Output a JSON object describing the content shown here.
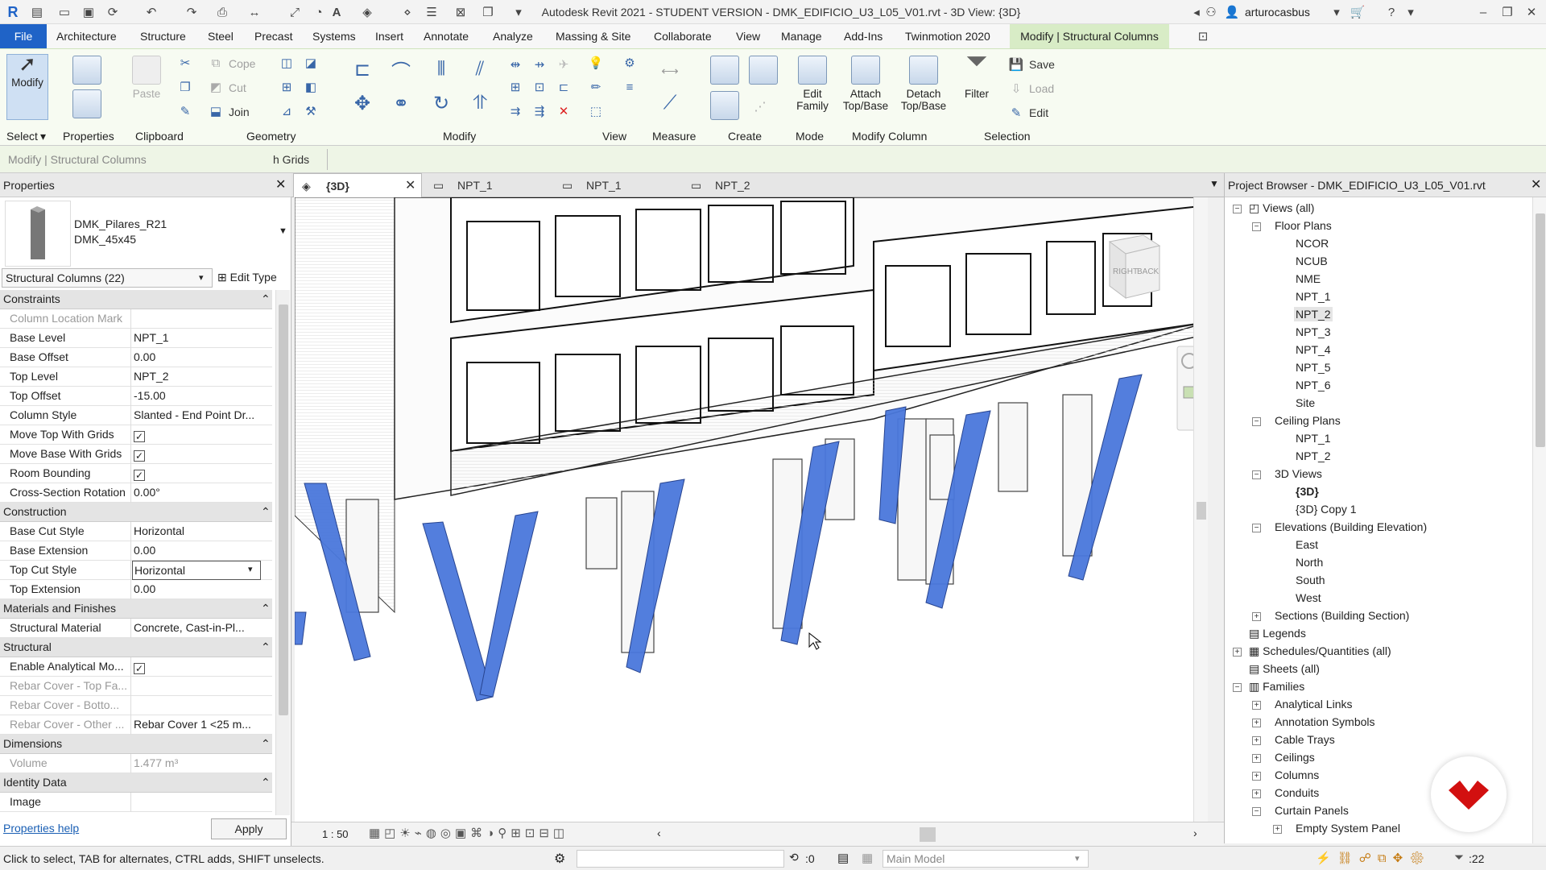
{
  "app": {
    "title": "Autodesk Revit 2021 - STUDENT VERSION - DMK_EDIFICIO_U3_L05_V01.rvt - 3D View: {3D}",
    "username": "arturocasbus"
  },
  "menu": [
    "File",
    "Architecture",
    "Structure",
    "Steel",
    "Precast",
    "Systems",
    "Insert",
    "Annotate",
    "Analyze",
    "Massing & Site",
    "Collaborate",
    "View",
    "Manage",
    "Add-Ins",
    "Twinmotion 2020",
    "Modify | Structural Columns"
  ],
  "ribbon": {
    "modify_label": "Modify",
    "paste_label": "Paste",
    "cope_label": "Cope",
    "cut_label": "Cut",
    "join_label": "Join",
    "edit_family_label": "Edit Family",
    "attach_label": "Attach Top/Base",
    "detach_label": "Detach Top/Base",
    "filter_label": "Filter",
    "save_label": "Save",
    "load_label": "Load",
    "edit_label": "Edit",
    "groups": [
      "Select",
      "Properties",
      "Clipboard",
      "Geometry",
      "Modify",
      "View",
      "Measure",
      "Create",
      "Mode",
      "Modify Column",
      "Selection"
    ]
  },
  "optionsbar": {
    "context_label": "Modify | Structural Columns",
    "grids_label": "h Grids"
  },
  "properties": {
    "title": "Properties",
    "family_name": "DMK_Pilares_R21",
    "type_name": "DMK_45x45",
    "selector": "Structural Columns (22)",
    "edit_type": "Edit Type",
    "groups": {
      "constraints": "Constraints",
      "construction": "Construction",
      "materials": "Materials and Finishes",
      "structural": "Structural",
      "dimensions": "Dimensions",
      "identity": "Identity Data"
    },
    "rows": {
      "col_location_mark": {
        "k": "Column Location Mark",
        "v": ""
      },
      "base_level": {
        "k": "Base Level",
        "v": "NPT_1"
      },
      "base_offset": {
        "k": "Base Offset",
        "v": "0.00"
      },
      "top_level": {
        "k": "Top Level",
        "v": "NPT_2"
      },
      "top_offset": {
        "k": "Top Offset",
        "v": "-15.00"
      },
      "column_style": {
        "k": "Column Style",
        "v": "Slanted - End Point Dr..."
      },
      "move_top": {
        "k": "Move Top With Grids",
        "v": "✓"
      },
      "move_base": {
        "k": "Move Base With Grids",
        "v": "✓"
      },
      "room_bounding": {
        "k": "Room Bounding",
        "v": "✓"
      },
      "cs_rotation": {
        "k": "Cross-Section Rotation",
        "v": "0.00°"
      },
      "base_cut_style": {
        "k": "Base Cut Style",
        "v": "Horizontal"
      },
      "base_extension": {
        "k": "Base Extension",
        "v": "0.00"
      },
      "top_cut_style": {
        "k": "Top Cut Style",
        "v": "Horizontal"
      },
      "top_extension": {
        "k": "Top Extension",
        "v": "0.00"
      },
      "structural_material": {
        "k": "Structural Material",
        "v": "Concrete, Cast-in-Pl..."
      },
      "enable_analytical": {
        "k": "Enable Analytical Mo...",
        "v": "✓"
      },
      "rebar_top": {
        "k": "Rebar Cover - Top Fa...",
        "v": ""
      },
      "rebar_bottom": {
        "k": "Rebar Cover - Botto...",
        "v": ""
      },
      "rebar_other": {
        "k": "Rebar Cover - Other ...",
        "v": "Rebar Cover 1 <25 m..."
      },
      "volume": {
        "k": "Volume",
        "v": "1.477 m³"
      },
      "image": {
        "k": "Image",
        "v": ""
      }
    },
    "help_link": "Properties help",
    "apply": "Apply"
  },
  "view_tabs": [
    "{3D}",
    "NPT_1",
    "NPT_1",
    "NPT_2"
  ],
  "view_status": {
    "scale": "1 : 50"
  },
  "browser": {
    "title": "Project Browser - DMK_EDIFICIO_U3_L05_V01.rvt",
    "items": [
      "Views (all)",
      "Floor Plans",
      "NCOR",
      "NCUB",
      "NME",
      "NPT_1",
      "NPT_2",
      "NPT_3",
      "NPT_4",
      "NPT_5",
      "NPT_6",
      "Site",
      "Ceiling Plans",
      "NPT_1",
      "NPT_2",
      "3D Views",
      "{3D}",
      "{3D} Copy 1",
      "Elevations (Building Elevation)",
      "East",
      "North",
      "South",
      "West",
      "Sections (Building Section)",
      "Legends",
      "Schedules/Quantities (all)",
      "Sheets (all)",
      "Families",
      "Analytical Links",
      "Annotation Symbols",
      "Cable Trays",
      "Ceilings",
      "Columns",
      "Conduits",
      "Curtain Panels",
      "Empty System Panel"
    ]
  },
  "statusbar": {
    "message": "Click to select, TAB for alternates, CTRL adds, SHIFT unselects.",
    "zero": ":0",
    "model": "Main Model",
    "filter_count": ":22"
  },
  "viewcube": {
    "right": "RIGHT",
    "back": "BACK"
  },
  "colors": {
    "accent": "#1f63c7",
    "context_tab": "#d8ecc6",
    "selection_blue": "#3d6ed8"
  }
}
